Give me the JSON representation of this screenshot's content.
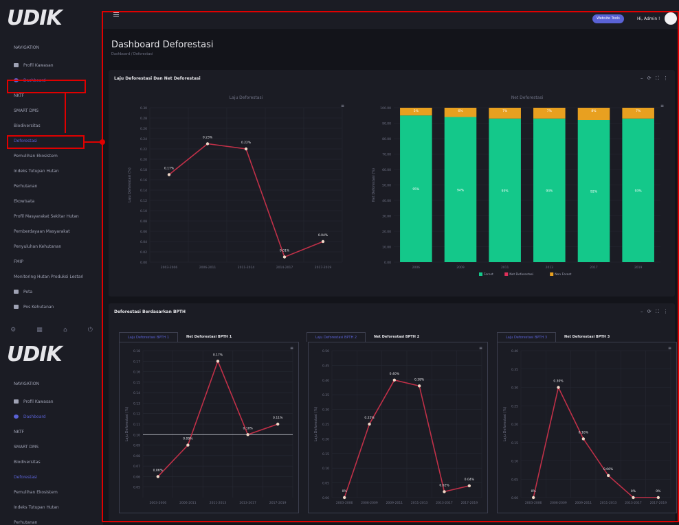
{
  "app": {
    "logo": "UDIK",
    "logo_sub": "SIST\nDATA\nINFORMASI\nKEHUTANAN"
  },
  "sidebar": {
    "section": "NAVIGATION",
    "items": [
      {
        "label": "Profil Kawasan",
        "icon": "profile-icon"
      },
      {
        "label": "Dashboard",
        "icon": "dashboard-icon",
        "active": true
      },
      {
        "label": "NKTF"
      },
      {
        "label": "SMART DMS"
      },
      {
        "label": "Biodiversitas"
      },
      {
        "label": "Deforestasi",
        "highlight": true
      },
      {
        "label": "Pemulihan Ekosistem"
      },
      {
        "label": "Indeks Tutupan Hutan"
      },
      {
        "label": "Perhutanan"
      },
      {
        "label": "Ekowisata"
      },
      {
        "label": "Profil Masyarakat Sekitar Hutan"
      },
      {
        "label": "Pemberdayaan Masyarakat"
      },
      {
        "label": "Penyuluhan Kehutanan"
      },
      {
        "label": "FMIP"
      },
      {
        "label": "Monitoring Hutan Produksi Lestari"
      },
      {
        "label": "Peta",
        "icon": "map-icon"
      },
      {
        "label": "Pos Kehutanan",
        "icon": "post-icon"
      }
    ],
    "items2": [
      {
        "label": "Profil Kawasan",
        "icon": "profile-icon"
      },
      {
        "label": "Dashboard",
        "icon": "dashboard-icon",
        "active": true
      },
      {
        "label": "NKTF"
      },
      {
        "label": "SMART DMS"
      },
      {
        "label": "Biodiversitas"
      },
      {
        "label": "Deforestasi",
        "highlight": true
      },
      {
        "label": "Pemulihan Ekosistem"
      },
      {
        "label": "Indeks Tutupan Hutan"
      },
      {
        "label": "Perhutanan"
      }
    ]
  },
  "topbar": {
    "button": "Website Tools",
    "greeting": "Hi, Admin !"
  },
  "page": {
    "title": "Dashboard Deforestasi",
    "breadcrumb": "Dashboard  /  Deforestasi"
  },
  "card1": {
    "title": "Laju Deforestasi Dan Net Deforestasi",
    "tools": "– ⟳ ⛶ ⋮"
  },
  "card2": {
    "title": "Deforestasi Berdasarkan BPTH",
    "tools": "– ⟳ ⛶ ⋮",
    "tabs": [
      {
        "on": "Laju Deforestasi BPTH 1",
        "off": "Net Deforestasi BPTH 1"
      },
      {
        "on": "Laju Deforestasi BPTH 2",
        "off": "Net Deforestasi BPTH 2"
      },
      {
        "on": "Laju Deforestasi BPTH 3",
        "off": "Net Deforestasi BPTH 3"
      }
    ]
  },
  "colors": {
    "line": "#c03048",
    "forest": "#14c88a",
    "nonforest": "#e8a020",
    "netdef": "#e0305a",
    "accent": "#5a62d6"
  },
  "chart_data": [
    {
      "type": "line",
      "title": "Laju Deforestasi",
      "ylabel": "Laju Deforestasi (%)",
      "categories": [
        "2003-2006",
        "2006-2011",
        "2011-2014",
        "2014-2017",
        "2017-2019"
      ],
      "values": [
        0.17,
        0.23,
        0.22,
        0.01,
        0.04
      ],
      "labels": [
        "0.17%",
        "0.23%",
        "0.22%",
        "0.01%",
        "0.04%"
      ],
      "yticks": [
        "0.30",
        "0.28",
        "0.26",
        "0.24",
        "0.22",
        "0.20",
        "0.18",
        "0.16",
        "0.14",
        "0.12",
        "0.10",
        "0.08",
        "0.06",
        "0.04",
        "0.02",
        "0.00"
      ],
      "ylim": [
        0,
        0.3
      ]
    },
    {
      "type": "bar",
      "title": "Net Deforestasi",
      "ylabel": "Net Deforestasi (%)",
      "categories": [
        "2006",
        "2009",
        "2011",
        "2013",
        "2017",
        "2019"
      ],
      "series": [
        {
          "name": "Forest",
          "values": [
            95,
            94,
            93,
            93,
            92,
            93
          ]
        },
        {
          "name": "Net Deforestasi",
          "values": [
            0,
            0,
            0,
            0,
            0,
            0
          ]
        },
        {
          "name": "Non Forest",
          "values": [
            5,
            6,
            7,
            7,
            8,
            7
          ]
        }
      ],
      "bar_labels": [
        "95%",
        "94%",
        "93%",
        "93%",
        "92%",
        "93%"
      ],
      "top_labels": [
        "5%",
        "6%",
        "7%",
        "7%",
        "8%",
        "7%"
      ],
      "yticks": [
        "100.00",
        "90.00",
        "80.00",
        "70.00",
        "60.00",
        "50.00",
        "40.00",
        "30.00",
        "20.00",
        "10.00",
        "0.00"
      ],
      "ylim": [
        0,
        100
      ]
    },
    {
      "type": "line",
      "title": "Laju Deforestasi BPTH 1",
      "ylabel": "Laju Deforestasi (%)",
      "categories": [
        "2003-2006",
        "2006-2011",
        "2011-2013",
        "2013-2017",
        "2017-2019"
      ],
      "values": [
        0.06,
        0.09,
        0.17,
        0.1,
        0.11
      ],
      "labels": [
        "0.06%",
        "0.09%",
        "0.17%",
        "0.10%",
        "0.11%"
      ],
      "yticks": [
        "0.18",
        "0.17",
        "0.16",
        "0.15",
        "0.14",
        "0.13",
        "0.12",
        "0.11",
        "0.10",
        "0.09",
        "0.08",
        "0.07",
        "0.06",
        "0.05"
      ],
      "ylim": [
        0.04,
        0.18
      ],
      "refline": 0.1
    },
    {
      "type": "line",
      "title": "Laju Deforestasi BPTH 2",
      "ylabel": "Laju Deforestasi (%)",
      "categories": [
        "2003-2006",
        "2006-2009",
        "2009-2011",
        "2011-2013",
        "2013-2017",
        "2017-2019"
      ],
      "values": [
        0,
        0.25,
        0.4,
        0.38,
        0.02,
        0.04
      ],
      "labels": [
        "0%",
        "0.25%",
        "0.40%",
        "0.38%",
        "0.02%",
        "0.04%"
      ],
      "yticks": [
        "0.50",
        "0.45",
        "0.40",
        "0.35",
        "0.30",
        "0.25",
        "0.20",
        "0.15",
        "0.10",
        "0.05",
        "0.00"
      ],
      "ylim": [
        0,
        0.5
      ]
    },
    {
      "type": "line",
      "title": "Laju Deforestasi BPTH 3",
      "ylabel": "Laju Deforestasi (%)",
      "categories": [
        "2003-2006",
        "2006-2009",
        "2009-2011",
        "2011-2013",
        "2013-2017",
        "2017-2019"
      ],
      "values": [
        0,
        0.3,
        0.16,
        0.06,
        0,
        0
      ],
      "labels": [
        "0%",
        "0.30%",
        "0.16%",
        "0.06%",
        "0%",
        "0%"
      ],
      "yticks": [
        "0.40",
        "0.35",
        "0.30",
        "0.25",
        "0.20",
        "0.15",
        "0.10",
        "0.05",
        "0.00"
      ],
      "ylim": [
        0,
        0.4
      ]
    }
  ]
}
